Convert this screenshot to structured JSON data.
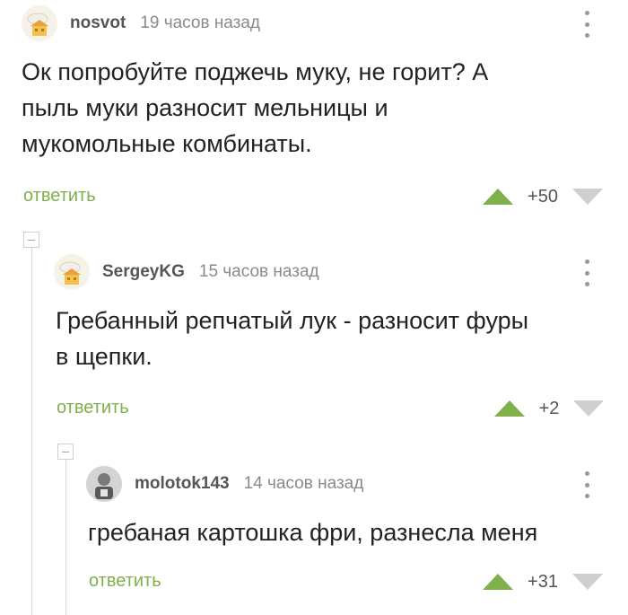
{
  "comments": [
    {
      "author": "nosvot",
      "time": "19 часов назад",
      "avatar": "house-avatar-icon",
      "text_lines": [
        "Ок попробуйте поджечь муку, не горит? А",
        "пыль муки разносит мельницы и",
        "мукомольные комбинаты."
      ],
      "reply_label": "ответить",
      "score": "+50"
    },
    {
      "author": "SergeyKG",
      "time": "15 часов назад",
      "avatar": "house-avatar-icon",
      "text_lines": [
        "Гребанный репчатый лук - разносит фуры",
        "в щепки."
      ],
      "reply_label": "ответить",
      "score": "+2"
    },
    {
      "author": "molotok143",
      "time": "14 часов назад",
      "avatar": "photo-avatar-icon",
      "text_lines": [
        "гребаная картошка фри, разнесла меня"
      ],
      "reply_label": "ответить",
      "score": "+31"
    }
  ],
  "colors": {
    "accent_green": "#7fb04c",
    "downvote_gray": "#cfcfcf",
    "meta_gray": "#8a8a8a",
    "text": "#222222"
  }
}
